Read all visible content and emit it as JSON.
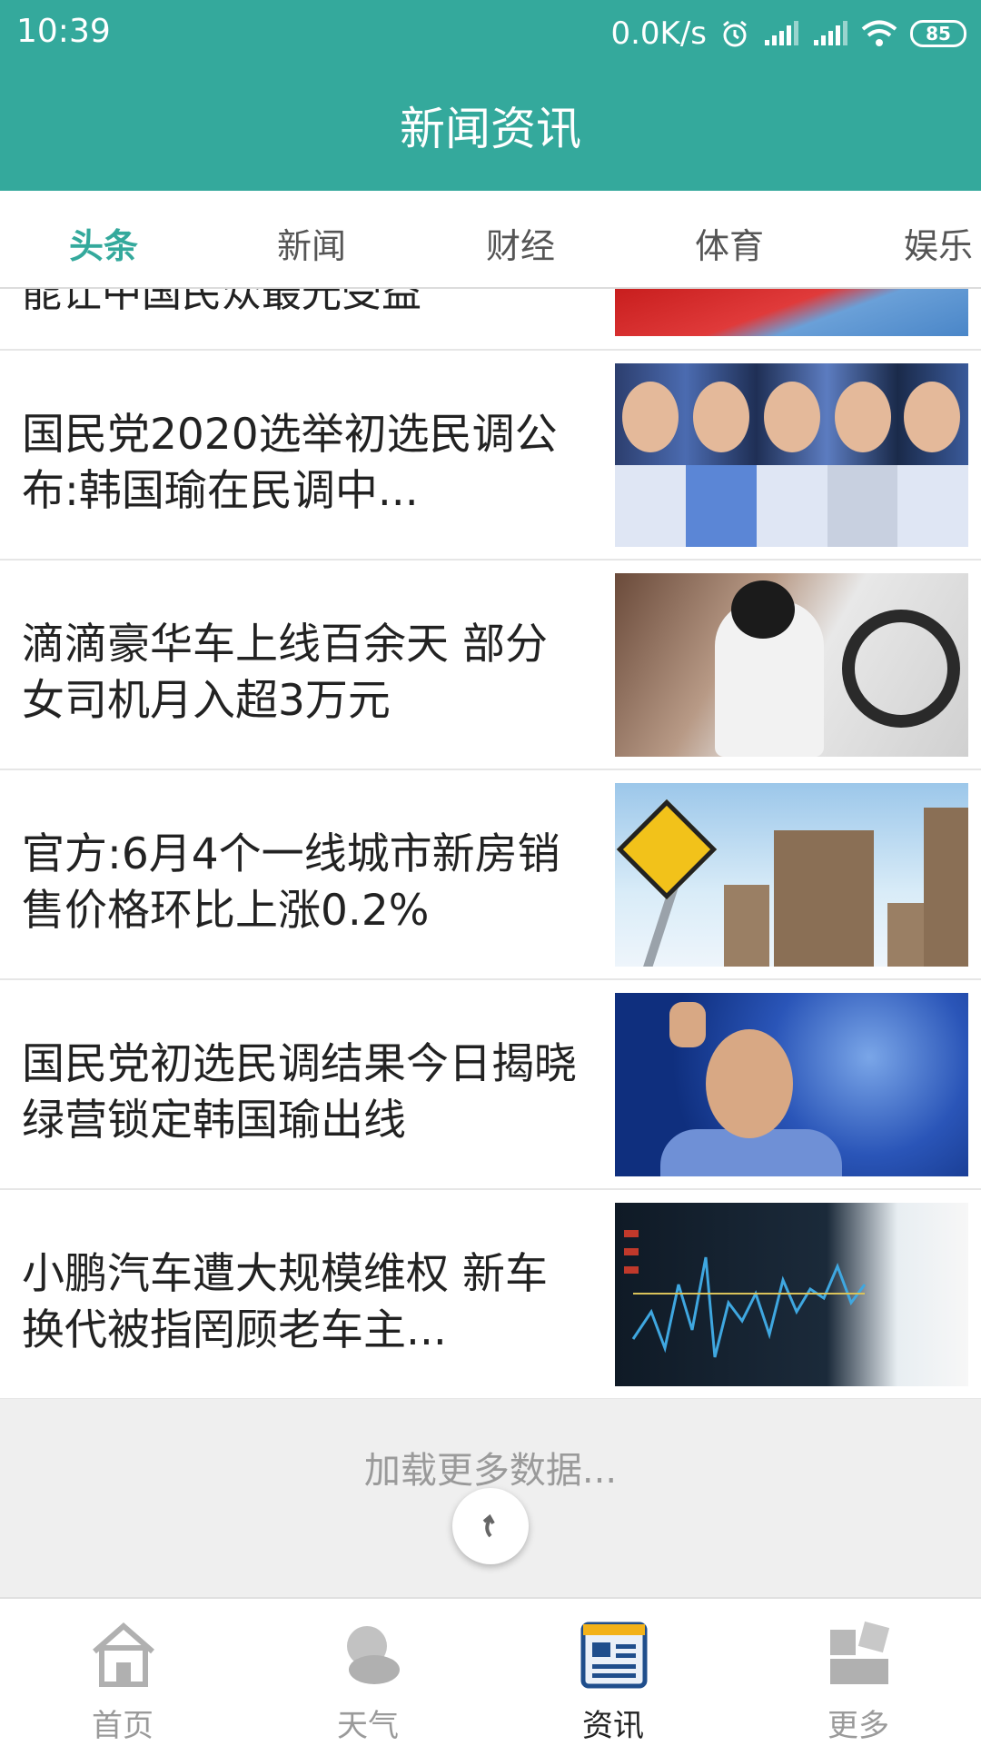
{
  "status_bar": {
    "time": "10:39",
    "network_speed": "0.0K/s",
    "battery_level": "85",
    "icons": [
      "alarm-icon",
      "signal-icon",
      "signal-icon",
      "wifi-icon",
      "battery-icon"
    ]
  },
  "header": {
    "title": "新闻资讯",
    "background_color": "#34a99c"
  },
  "tabs": [
    {
      "label": "头条",
      "active": true
    },
    {
      "label": "新闻",
      "active": false
    },
    {
      "label": "财经",
      "active": false
    },
    {
      "label": "体育",
      "active": false
    },
    {
      "label": "娱乐",
      "active": false
    }
  ],
  "partial_item": {
    "title": "能让中国民众最光受益"
  },
  "news": [
    {
      "title": "国民党2020选举初选民调公布:韩国瑜在民调中...",
      "thumbnail": "politicians-photo"
    },
    {
      "title": "滴滴豪华车上线百余天 部分女司机月入超3万元",
      "thumbnail": "driver-photo"
    },
    {
      "title": "官方:6月4个一线城市新房销售价格环比上涨0.2%",
      "thumbnail": "city-buildings-photo"
    },
    {
      "title": "国民党初选民调结果今日揭晓 绿营锁定韩国瑜出线",
      "thumbnail": "speaker-photo"
    },
    {
      "title": "小鹏汽车遭大规模维权 新车换代被指罔顾老车主...",
      "thumbnail": "stock-chart-photo"
    }
  ],
  "load_more": {
    "text": "加载更多数据...",
    "refresh_icon": "refresh-icon"
  },
  "bottom_nav": [
    {
      "label": "首页",
      "icon": "home-icon",
      "active": false
    },
    {
      "label": "天气",
      "icon": "weather-icon",
      "active": false
    },
    {
      "label": "资讯",
      "icon": "news-icon",
      "active": true
    },
    {
      "label": "更多",
      "icon": "more-icon",
      "active": false
    }
  ],
  "colors": {
    "accent": "#34a99c",
    "inactive_nav": "#9a9a9a",
    "active_nav_icon": "#1f4e8c"
  }
}
